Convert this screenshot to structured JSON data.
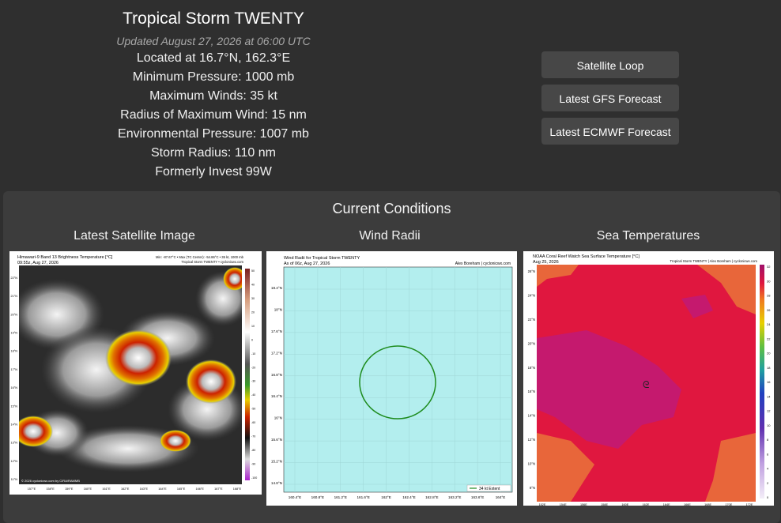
{
  "storm": {
    "title": "Tropical Storm TWENTY",
    "updated": "Updated August 27, 2026 at 06:00 UTC",
    "location": "Located at 16.7°N, 162.3°E",
    "pressure": "Minimum Pressure: 1000 mb",
    "winds": "Maximum Winds: 35 kt",
    "rmw": "Radius of Maximum Wind: 15 nm",
    "env_pressure": "Environmental Pressure: 1007 mb",
    "radius": "Storm Radius: 110 nm",
    "formerly": "Formerly Invest 99W"
  },
  "buttons": {
    "satellite_loop": "Satellite Loop",
    "gfs": "Latest GFS Forecast",
    "ecmwf": "Latest ECMWF Forecast"
  },
  "conditions": {
    "title": "Current Conditions",
    "satellite": {
      "heading": "Latest Satellite Image",
      "caption1": "Himawari-9 Band 13 Brightness Temperature [°C]",
      "caption2": "09:55z, Aug 27, 2026",
      "caption3": "Min: -87.67°C • Max (TC Center): -54.86°C • 35 kt, 1000 mb",
      "caption4": "Tropical Storm TWENTY • cyclonicwx.com",
      "footer": "© 2026 cyclonicwx.com by CIRA/RAMMB",
      "lat_labels": [
        "22°N",
        "21°N",
        "20°N",
        "19°N",
        "18°N",
        "17°N",
        "16°N",
        "15°N",
        "14°N",
        "13°N",
        "12°N",
        "11°N"
      ],
      "lon_labels": [
        "157°E",
        "158°E",
        "159°E",
        "160°E",
        "161°E",
        "162°E",
        "163°E",
        "164°E",
        "165°E",
        "166°E",
        "167°E",
        "168°E"
      ],
      "scale_labels": [
        "50",
        "40",
        "30",
        "20",
        "10",
        "0",
        "-10",
        "-20",
        "-30",
        "-40",
        "-50",
        "-60",
        "-70",
        "-80",
        "-90",
        "-100"
      ],
      "colors": {
        "cold": "#ffffff",
        "warm": "#1a1a1a",
        "red": "#cc2200",
        "orange": "#e07000",
        "yellow": "#e8d000",
        "green": "#3a9a2a"
      }
    },
    "wind": {
      "heading": "Wind Radii",
      "caption1": "Wind Radii for Tropical Storm TWENTY",
      "caption2": "As of 06z, Aug 27, 2026",
      "caption3": "Alex Boreham | cyclonicwx.com",
      "legend": "34 kt Extent",
      "lat_labels": [
        "18.4°N",
        "18°N",
        "17.6°N",
        "17.2°N",
        "16.8°N",
        "16.4°N",
        "16°N",
        "15.6°N",
        "15.2°N",
        "14.8°N"
      ],
      "lon_labels": [
        "160.4°E",
        "160.8°E",
        "161.2°E",
        "161.6°E",
        "162°E",
        "162.4°E",
        "162.8°E",
        "163.2°E",
        "163.6°E",
        "164°E"
      ],
      "colors": {
        "ocean": "#b3eeee",
        "circle": "#1e8c1e"
      }
    },
    "sst": {
      "heading": "Sea Temperatures",
      "caption1": "NOAA Coral Reef Watch Sea Surface Temperature [°C]",
      "caption2": "Aug 25, 2026",
      "caption3": "Tropical Storm TWENTY | Alex Boreham | cyclonicwx.com",
      "lat_labels": [
        "26°N",
        "24°N",
        "22°N",
        "20°N",
        "18°N",
        "16°N",
        "14°N",
        "12°N",
        "10°N",
        "8°N"
      ],
      "lon_labels": [
        "152E",
        "154E",
        "156E",
        "158E",
        "160E",
        "162E",
        "164E",
        "166E",
        "168E",
        "170E",
        "172E"
      ],
      "scale_labels": [
        "32",
        "30",
        "28",
        "26",
        "24",
        "22",
        "20",
        "18",
        "16",
        "14",
        "12",
        "10",
        "8",
        "6",
        "4",
        "2",
        "0"
      ],
      "colors": {
        "warm": "#e0173f",
        "warmer": "#c5196e",
        "cooler": "#e8663a"
      }
    }
  }
}
